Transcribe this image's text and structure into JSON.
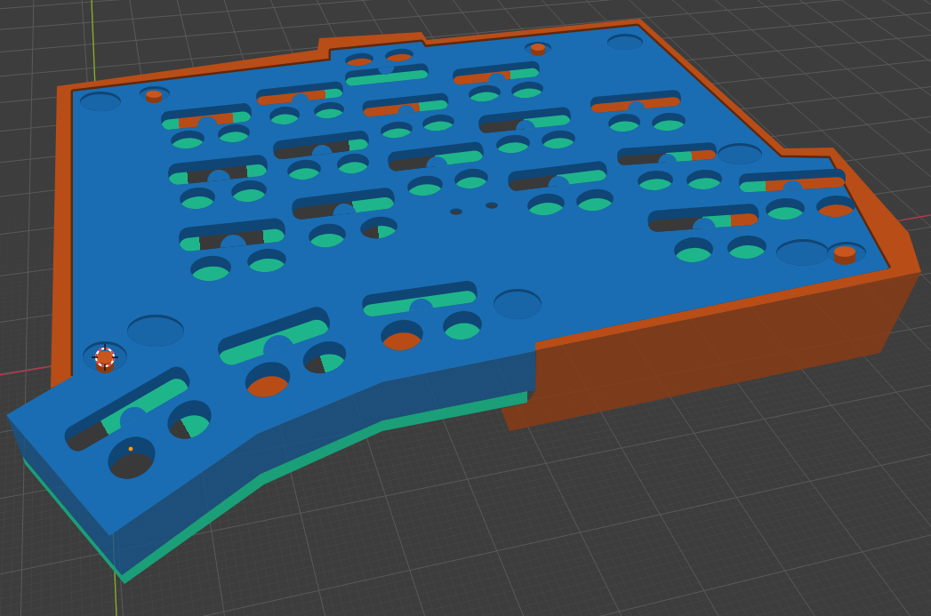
{
  "viewport": {
    "grid": true,
    "axes": true,
    "cursor": true,
    "origin": true
  }
}
